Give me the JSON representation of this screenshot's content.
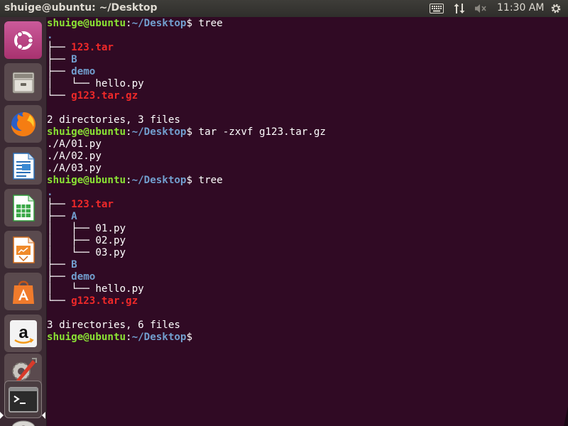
{
  "topbar": {
    "window_title": "shuige@ubuntu: ~/Desktop",
    "clock": "11:30 AM",
    "icons": [
      "keyboard-icon",
      "network-icon",
      "volume-muted-icon",
      "gear-icon"
    ]
  },
  "launcher": {
    "items": [
      "ubuntu-dash",
      "files",
      "firefox",
      "libreoffice-writer",
      "libreoffice-calc",
      "libreoffice-impress",
      "ubuntu-software",
      "amazon",
      "system-settings",
      "terminal",
      "dvd"
    ],
    "active": "terminal"
  },
  "terminal": {
    "user": "shuige@ubuntu",
    "colon": ":",
    "path": "~/Desktop",
    "sigil": "$",
    "lines": [
      {
        "kind": "prompt",
        "cmd": " tree"
      },
      {
        "kind": "text",
        "pre": ".",
        "text": "",
        "style": "dot"
      },
      {
        "kind": "text",
        "pre": "├── ",
        "text": "123.tar",
        "style": "red"
      },
      {
        "kind": "text",
        "pre": "├── ",
        "text": "B",
        "style": "blue"
      },
      {
        "kind": "text",
        "pre": "├── ",
        "text": "demo",
        "style": "blue"
      },
      {
        "kind": "text",
        "pre": "│   └── ",
        "text": "hello.py",
        "style": "plain"
      },
      {
        "kind": "text",
        "pre": "└── ",
        "text": "g123.tar.gz",
        "style": "red"
      },
      {
        "kind": "text",
        "pre": "",
        "text": "",
        "style": "plain"
      },
      {
        "kind": "text",
        "pre": "",
        "text": "2 directories, 3 files",
        "style": "plain"
      },
      {
        "kind": "prompt",
        "cmd": " tar -zxvf g123.tar.gz"
      },
      {
        "kind": "text",
        "pre": "",
        "text": "./A/01.py",
        "style": "plain"
      },
      {
        "kind": "text",
        "pre": "",
        "text": "./A/02.py",
        "style": "plain"
      },
      {
        "kind": "text",
        "pre": "",
        "text": "./A/03.py",
        "style": "plain"
      },
      {
        "kind": "prompt",
        "cmd": " tree"
      },
      {
        "kind": "text",
        "pre": ".",
        "text": "",
        "style": "dot"
      },
      {
        "kind": "text",
        "pre": "├── ",
        "text": "123.tar",
        "style": "red"
      },
      {
        "kind": "text",
        "pre": "├── ",
        "text": "A",
        "style": "blue"
      },
      {
        "kind": "text",
        "pre": "│   ├── ",
        "text": "01.py",
        "style": "plain"
      },
      {
        "kind": "text",
        "pre": "│   ├── ",
        "text": "02.py",
        "style": "plain"
      },
      {
        "kind": "text",
        "pre": "│   └── ",
        "text": "03.py",
        "style": "plain"
      },
      {
        "kind": "text",
        "pre": "├── ",
        "text": "B",
        "style": "blue"
      },
      {
        "kind": "text",
        "pre": "├── ",
        "text": "demo",
        "style": "blue"
      },
      {
        "kind": "text",
        "pre": "│   └── ",
        "text": "hello.py",
        "style": "plain"
      },
      {
        "kind": "text",
        "pre": "└── ",
        "text": "g123.tar.gz",
        "style": "red"
      },
      {
        "kind": "text",
        "pre": "",
        "text": "",
        "style": "plain"
      },
      {
        "kind": "text",
        "pre": "",
        "text": "3 directories, 6 files",
        "style": "plain"
      },
      {
        "kind": "prompt",
        "cmd": ""
      }
    ]
  },
  "colors": {
    "terminal_bg": "#300a24",
    "prompt_user": "#8ae234",
    "prompt_path": "#729fcf",
    "archive": "#ef2929",
    "directory": "#729fcf"
  }
}
